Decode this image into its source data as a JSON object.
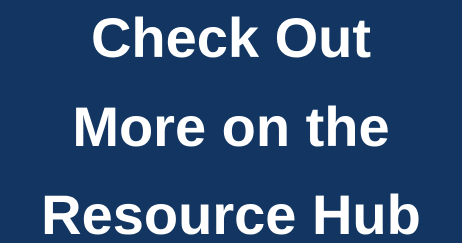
{
  "banner": {
    "lines": [
      "Check Out",
      "More on the",
      "Resource Hub"
    ]
  },
  "colors": {
    "background": "#123561",
    "text": "#ffffff"
  }
}
